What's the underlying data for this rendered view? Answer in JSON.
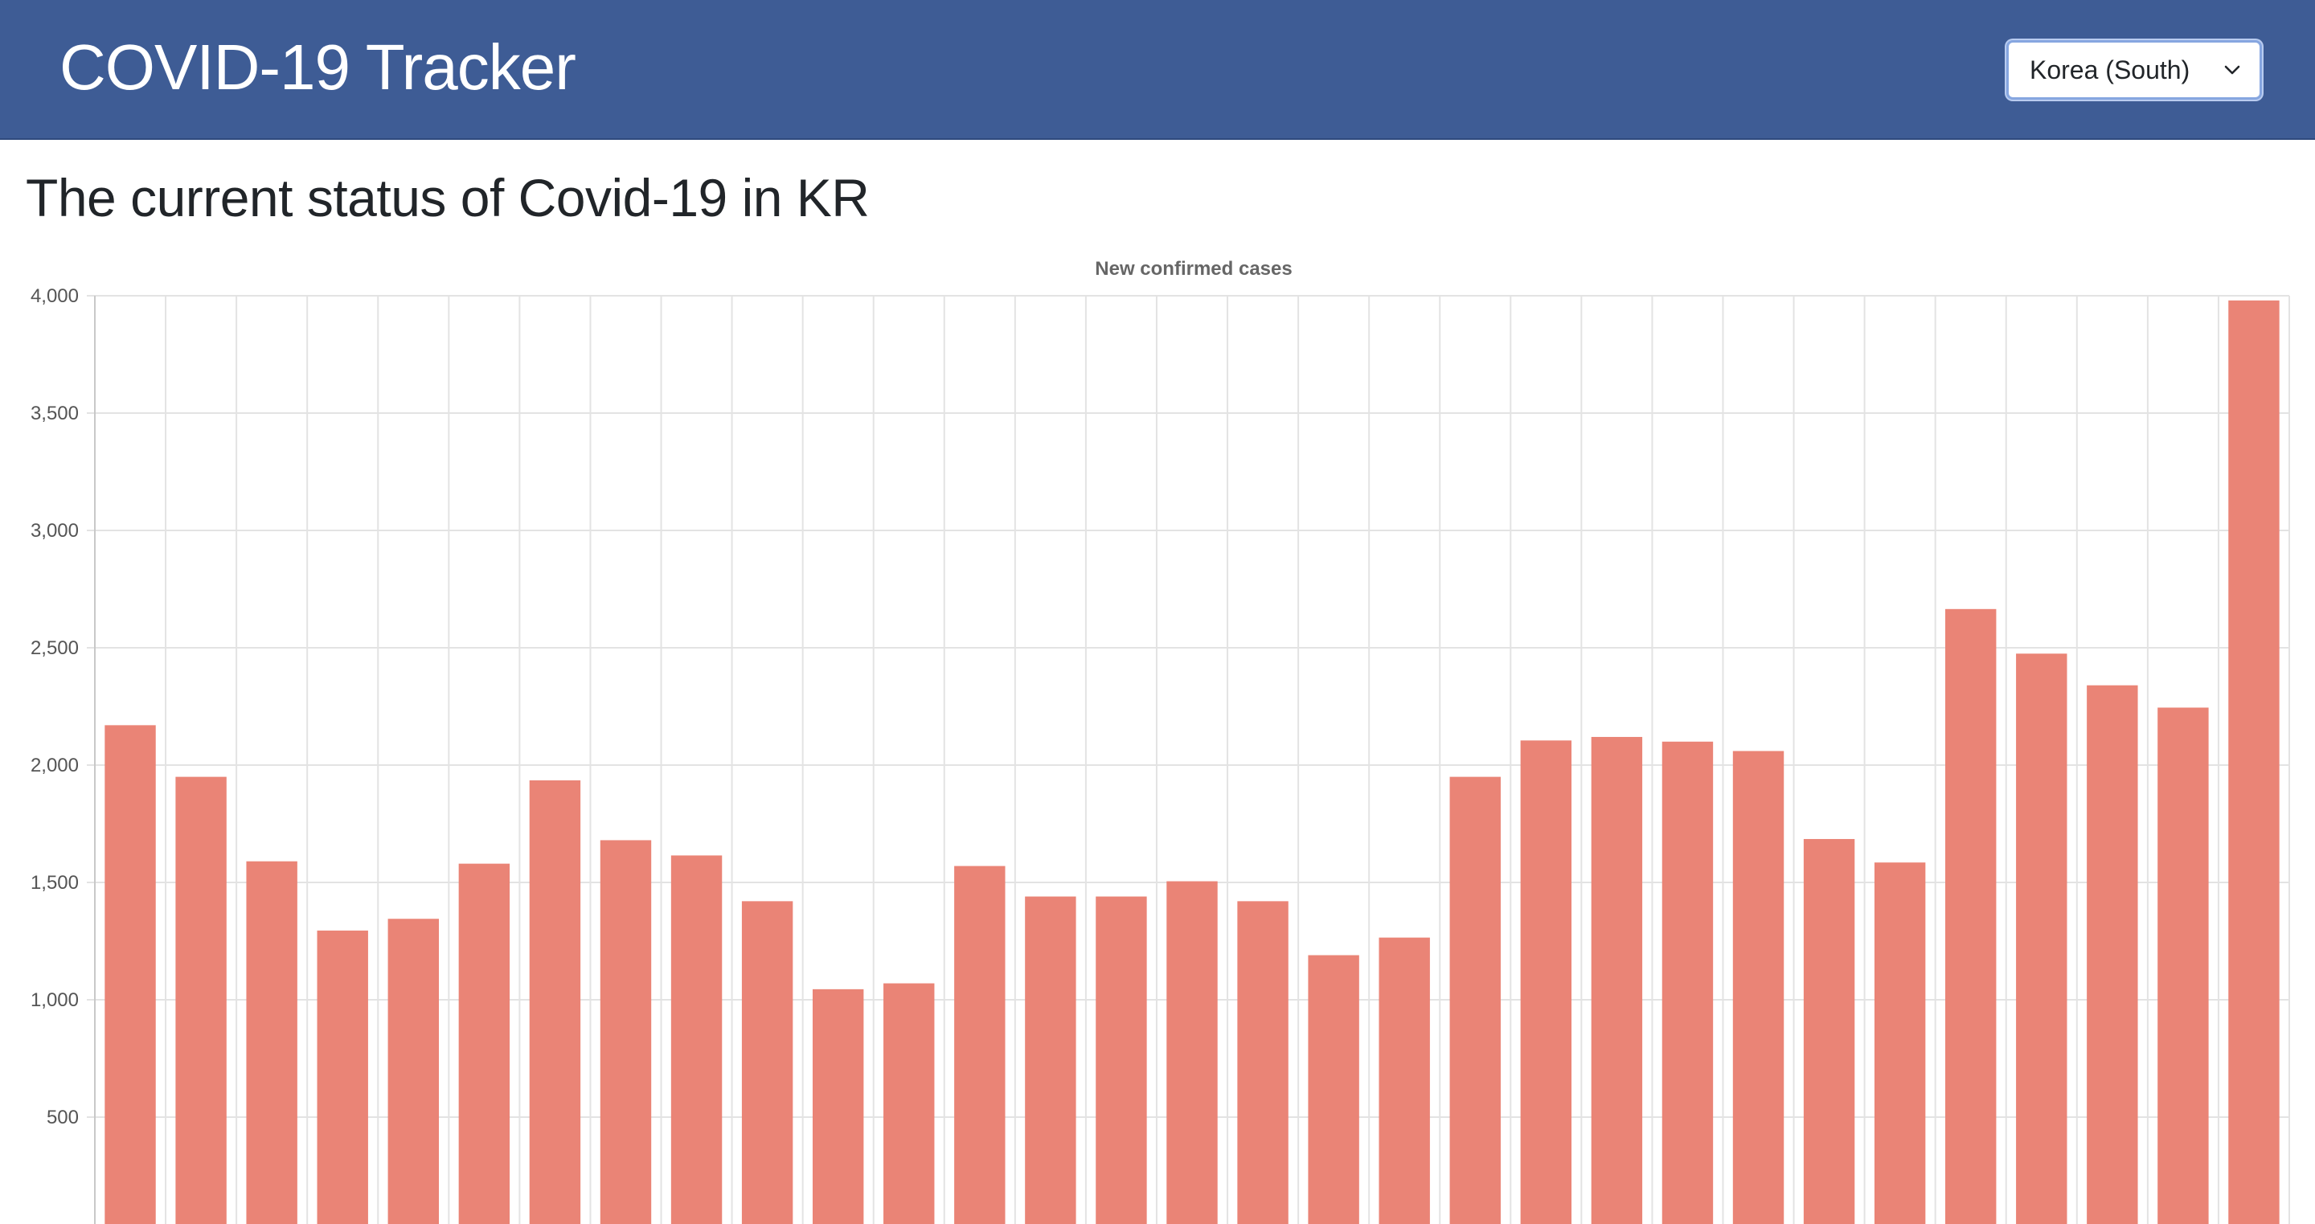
{
  "header": {
    "brand": "COVID-19 Tracker",
    "country_select": {
      "selected": "Korea (South)",
      "icon": "chevron-down-icon"
    }
  },
  "main": {
    "title": "The current status of Covid-19 in KR"
  },
  "colors": {
    "navbar": "#3e5c95",
    "bar": "#ea8476",
    "grid": "#e3e3e3"
  },
  "chart_data": {
    "type": "bar",
    "title": "New confirmed cases",
    "xlabel": "",
    "ylabel": "",
    "ylim": [
      0,
      4000
    ],
    "yticks": [
      500,
      1000,
      1500,
      2000,
      2500,
      3000,
      3500,
      4000
    ],
    "ytick_labels": [
      "500",
      "1,000",
      "1,500",
      "2,000",
      "2,500",
      "3,000",
      "3,500",
      "4,000"
    ],
    "grid": true,
    "values": [
      2170,
      1950,
      1590,
      1295,
      1345,
      1580,
      1935,
      1680,
      1615,
      1420,
      1045,
      1070,
      1570,
      1440,
      1440,
      1505,
      1420,
      1190,
      1265,
      1950,
      2105,
      2120,
      2100,
      2060,
      1685,
      1585,
      2665,
      2475,
      2340,
      2245,
      3980
    ]
  }
}
